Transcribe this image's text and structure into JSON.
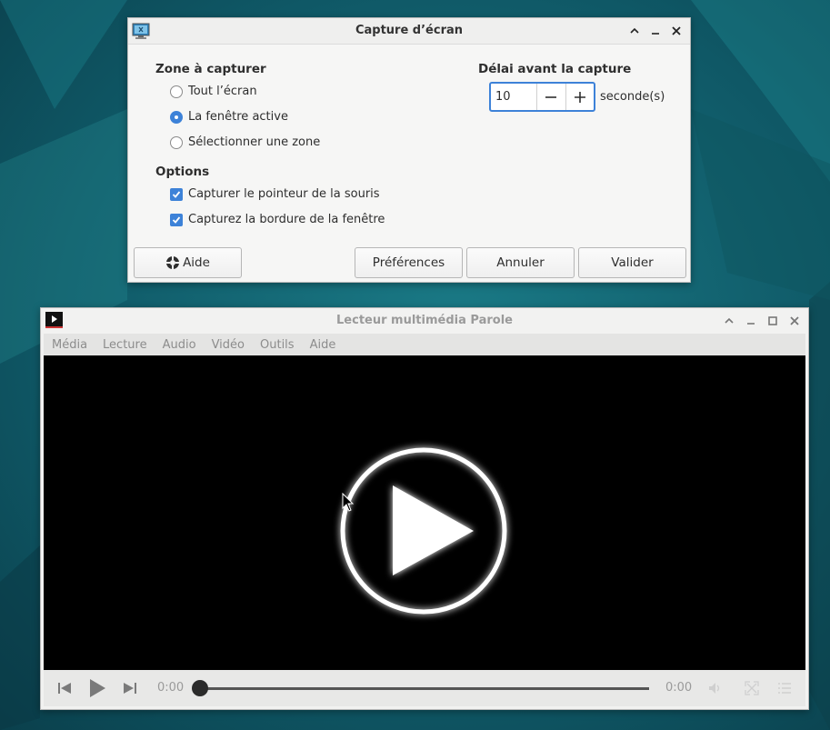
{
  "dialog": {
    "title": "Capture d’écran",
    "area_heading": "Zone à capturer",
    "area_options": [
      {
        "label": "Tout l’écran",
        "checked": false
      },
      {
        "label": "La fenêtre active",
        "checked": true
      },
      {
        "label": "Sélectionner une zone",
        "checked": false
      }
    ],
    "delay_heading": "Délai avant la capture",
    "delay_value": "10",
    "delay_unit": "seconde(s)",
    "options_heading": "Options",
    "options": [
      {
        "label": "Capturer le pointeur de la souris",
        "checked": true
      },
      {
        "label": "Capturez la bordure de la fenêtre",
        "checked": true
      }
    ],
    "buttons": {
      "help": "Aide",
      "preferences": "Préférences",
      "cancel": "Annuler",
      "ok": "Valider"
    }
  },
  "player": {
    "title": "Lecteur multimédia Parole",
    "menu": [
      "Média",
      "Lecture",
      "Audio",
      "Vidéo",
      "Outils",
      "Aide"
    ],
    "time_elapsed": "0:00",
    "time_total": "0:00",
    "progress": 0
  },
  "colors": {
    "accent": "#3d82d8",
    "desktop": "#0d4a56",
    "video_bg": "#000000"
  }
}
